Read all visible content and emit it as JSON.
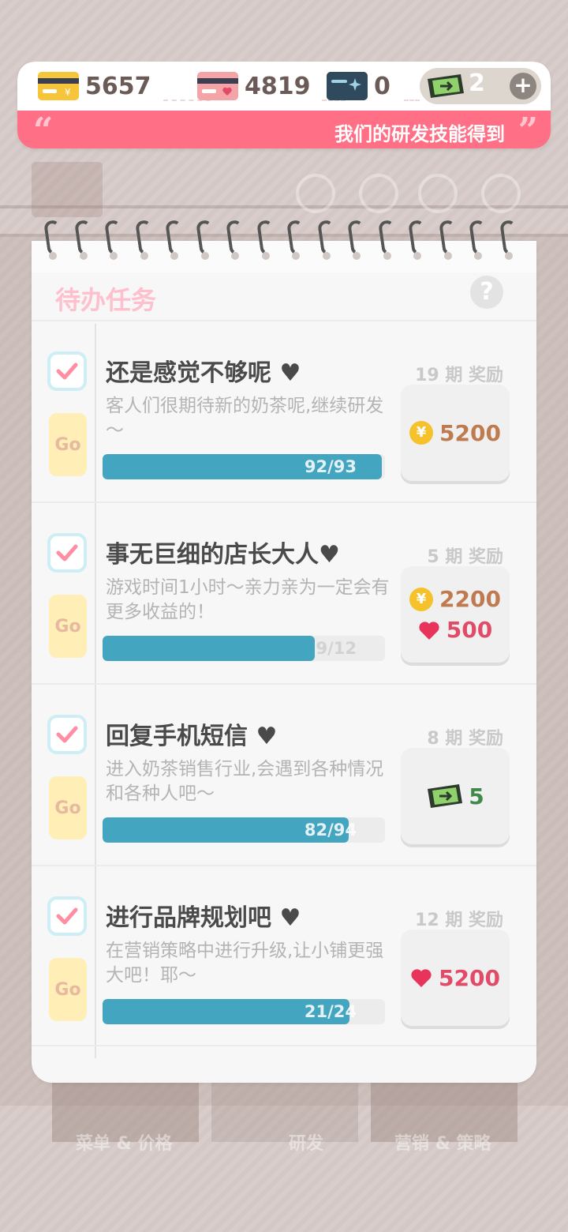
{
  "resources": {
    "gold_card": {
      "value": "5657",
      "icon": "gold-card-icon",
      "color": "#f6c53a"
    },
    "pink_card": {
      "value": "4819",
      "icon": "pink-card-icon",
      "color": "#f4a3a6"
    },
    "blue_card": {
      "value": "0",
      "icon": "blue-card-icon",
      "color": "#2f4a5c"
    },
    "tickets": {
      "value": "2",
      "icon": "ticket-icon",
      "color": "#3a4a38"
    }
  },
  "banner": {
    "text": "我们的研发技能得到"
  },
  "notebook": {
    "title": "待办任务",
    "help_label": "?"
  },
  "tasks": [
    {
      "title": "还是感觉不够呢 ♥",
      "desc": "客人们很期待新的奶茶呢,继续研发～",
      "go": "Go",
      "progress_text": "92/93",
      "progress": 0.989,
      "period": "19 期  奖励",
      "rewards": [
        {
          "type": "coin",
          "value": "5200"
        }
      ]
    },
    {
      "title": "事无巨细的店长大人♥",
      "desc": "游戏时间1小时～亲力亲为一定会有更多收益的！",
      "go": "Go",
      "progress_text": "9/12",
      "progress": 0.75,
      "period": "5 期  奖励",
      "rewards": [
        {
          "type": "coin",
          "value": "2200"
        },
        {
          "type": "heart",
          "value": "500"
        }
      ]
    },
    {
      "title": "回复手机短信 ♥",
      "desc": "进入奶茶销售行业,会遇到各种情况和各种人吧～",
      "go": "Go",
      "progress_text": "82/94",
      "progress": 0.872,
      "period": "8 期  奖励",
      "rewards": [
        {
          "type": "ticket",
          "value": "5"
        }
      ]
    },
    {
      "title": "进行品牌规划吧 ♥",
      "desc": "在营销策略中进行升级,让小铺更强大吧！耶～",
      "go": "Go",
      "progress_text": "21/24",
      "progress": 0.875,
      "period": "12 期  奖励",
      "rewards": [
        {
          "type": "heart",
          "value": "5200"
        }
      ]
    }
  ],
  "bottom_tabs": {
    "left": "菜单 & 价格",
    "center": "研发",
    "right": "营销 & 策略"
  }
}
